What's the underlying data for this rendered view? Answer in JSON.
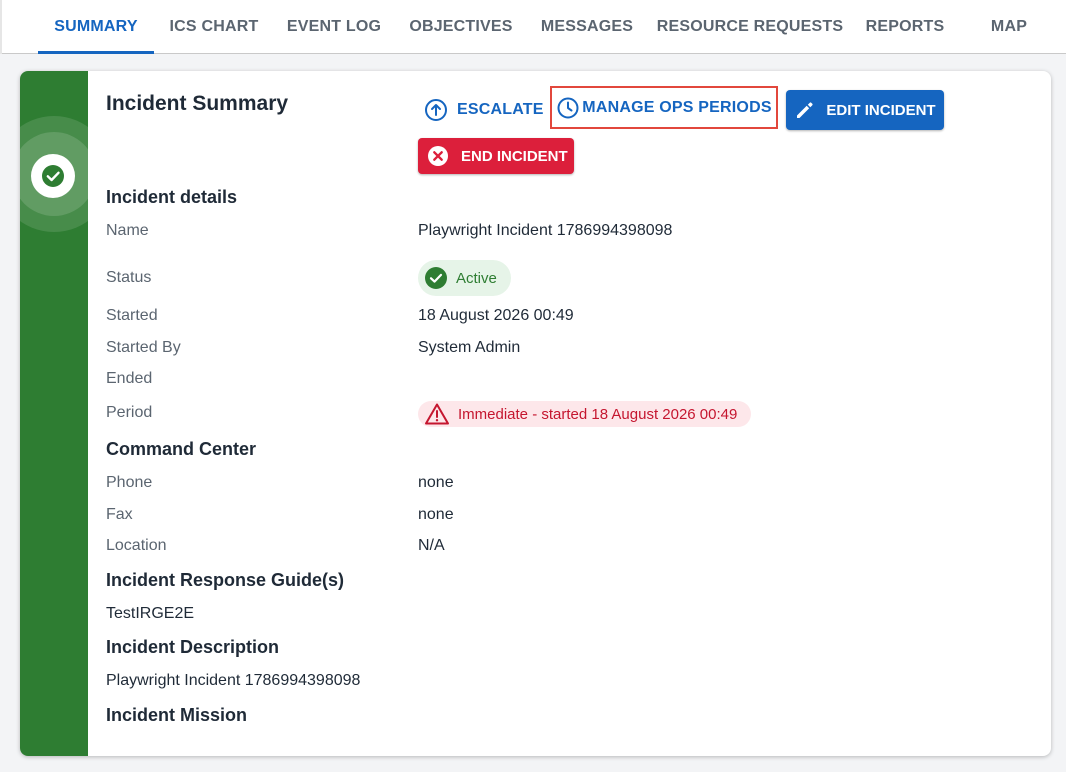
{
  "tabs": [
    {
      "label": "SUMMARY",
      "active": true
    },
    {
      "label": "ICS CHART",
      "active": false
    },
    {
      "label": "EVENT LOG",
      "active": false
    },
    {
      "label": "OBJECTIVES",
      "active": false
    },
    {
      "label": "MESSAGES",
      "active": false
    },
    {
      "label": "RESOURCE REQUESTS",
      "active": false
    },
    {
      "label": "REPORTS",
      "active": false
    },
    {
      "label": "MAP",
      "active": false
    }
  ],
  "colors": {
    "primary": "#1565c0",
    "status_green": "#2e7d32",
    "danger": "#dc1f3b",
    "highlight_border": "#e2473c"
  },
  "summary": {
    "title": "Incident Summary",
    "status_icon": "check-circle-icon",
    "actions": {
      "escalate": {
        "label": "ESCALATE",
        "icon": "arrow-up-circle-icon"
      },
      "manage_ops": {
        "label": "MANAGE OPS PERIODS",
        "icon": "clock-icon"
      },
      "edit": {
        "label": "EDIT INCIDENT",
        "icon": "pencil-icon"
      },
      "end": {
        "label": "END INCIDENT",
        "icon": "close-circle-icon"
      }
    }
  },
  "details": {
    "heading": "Incident details",
    "name_label": "Name",
    "name_value": "Playwright Incident 1786994398098",
    "status_label": "Status",
    "status_value": "Active",
    "started_label": "Started",
    "started_value": "18 August 2026 00:49",
    "started_by_label": "Started By",
    "started_by_value": "System Admin",
    "ended_label": "Ended",
    "period_label": "Period",
    "period_value": "Immediate - started 18 August 2026 00:49"
  },
  "command_center": {
    "heading": "Command Center",
    "phone_label": "Phone",
    "phone_value": "none",
    "fax_label": "Fax",
    "fax_value": "none",
    "location_label": "Location",
    "location_value": "N/A"
  },
  "response_guides": {
    "heading": "Incident Response Guide(s)",
    "item": "TestIRGE2E"
  },
  "description": {
    "heading": "Incident Description",
    "text": "Playwright Incident 1786994398098"
  },
  "mission": {
    "heading": "Incident Mission"
  }
}
